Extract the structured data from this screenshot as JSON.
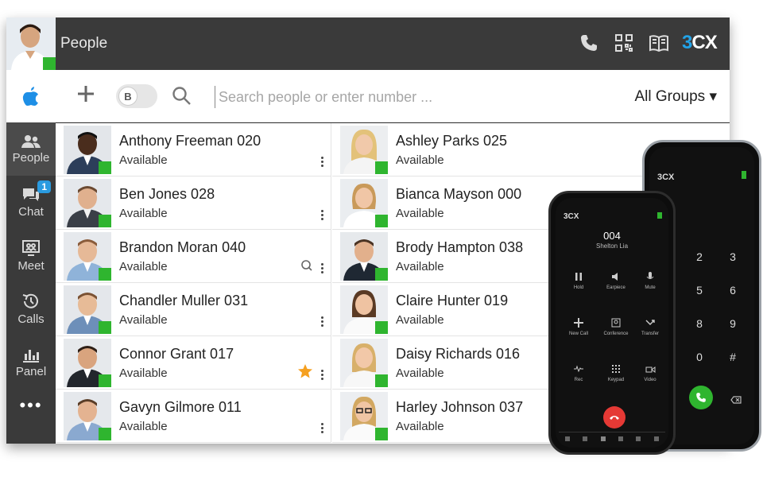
{
  "header": {
    "title": "People",
    "brand_left": "3",
    "brand_right": "CX"
  },
  "sidebar": {
    "items": [
      {
        "label": "People",
        "icon": "people-icon",
        "active": true
      },
      {
        "label": "Chat",
        "icon": "chat-icon",
        "badge": "1"
      },
      {
        "label": "Meet",
        "icon": "meet-icon"
      },
      {
        "label": "Calls",
        "icon": "history-icon"
      },
      {
        "label": "Panel",
        "icon": "panel-icon"
      }
    ],
    "more": "•••"
  },
  "toolbar": {
    "toggle_letter": "B",
    "search_placeholder": "Search people or enter number ...",
    "groups_label": "All Groups ▾"
  },
  "contacts": {
    "left": [
      {
        "name": "Anthony Freeman 020",
        "status": "Available"
      },
      {
        "name": "Ben Jones 028",
        "status": "Available"
      },
      {
        "name": "Brandon Moran 040",
        "status": "Available"
      },
      {
        "name": "Chandler Muller 031",
        "status": "Available"
      },
      {
        "name": "Connor Grant 017",
        "status": "Available"
      },
      {
        "name": "Gavyn Gilmore 011",
        "status": "Available"
      }
    ],
    "right": [
      {
        "name": "Ashley Parks 025",
        "status": "Available"
      },
      {
        "name": "Bianca Mayson 000",
        "status": "Available"
      },
      {
        "name": "Brody Hampton 038",
        "status": "Available"
      },
      {
        "name": "Claire Hunter 019",
        "status": "Available"
      },
      {
        "name": "Daisy Richards 016",
        "status": "Available"
      },
      {
        "name": "Harley Johnson 037",
        "status": "Available"
      }
    ]
  },
  "phone_call": {
    "brand": "3CX",
    "number": "004",
    "caller": "Shelton Lia",
    "buttons": [
      "Hold",
      "Earpiece",
      "Mute",
      "New Call",
      "Conference",
      "Transfer",
      "Rec",
      "Keypad",
      "Video"
    ]
  },
  "phone_dial": {
    "brand": "3CX",
    "keys": [
      "2",
      "3",
      "5",
      "6",
      "8",
      "9",
      "0",
      "#"
    ]
  },
  "colors": {
    "presence": "#2fb52f",
    "accent": "#22a3e8",
    "topbar": "#3a3a3a",
    "hangup": "#e53935",
    "answer": "#2fb52f"
  }
}
